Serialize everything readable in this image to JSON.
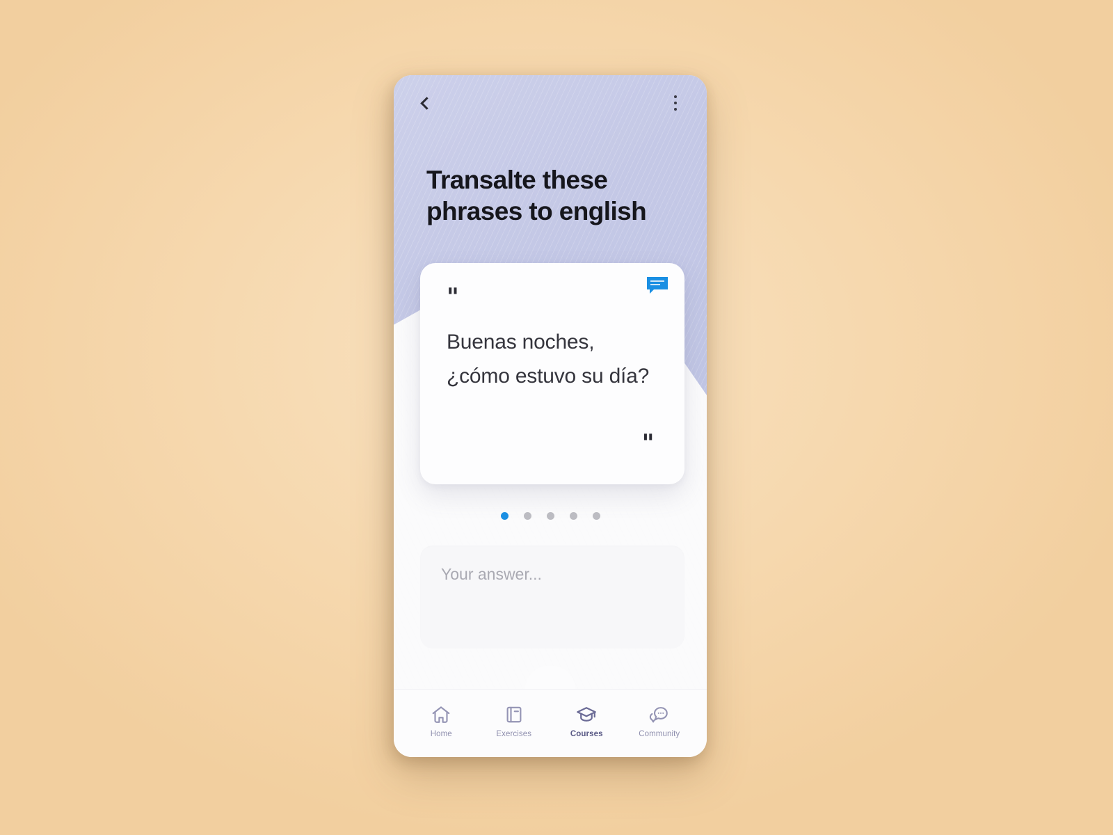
{
  "theme": {
    "page_background": "#f6d9b0",
    "header_purple": "#c4c8e6",
    "accent_blue": "#1a8fe3",
    "nav_inactive": "#8f8fae",
    "nav_active": "#585884",
    "card_background": "#fdfdfe"
  },
  "topbar": {
    "back_icon": "chevron-left-icon",
    "menu_icon": "kebab-menu-icon"
  },
  "header": {
    "title": "Transalte these phrases to english"
  },
  "phrase_card": {
    "open_quote": "\"",
    "close_quote": "\"",
    "icon": "speech-bubble-icon",
    "text": "Buenas noches, ¿cómo estuvo su día?"
  },
  "pagination": {
    "total": 5,
    "active_index": 0,
    "dots": [
      {
        "active": true
      },
      {
        "active": false
      },
      {
        "active": false
      },
      {
        "active": false
      },
      {
        "active": false
      }
    ]
  },
  "answer": {
    "placeholder": "Your answer...",
    "value": ""
  },
  "bottom_nav": {
    "items": [
      {
        "label": "Home",
        "icon": "home-icon",
        "active": false
      },
      {
        "label": "Exercises",
        "icon": "book-icon",
        "active": false
      },
      {
        "label": "Courses",
        "icon": "graduation-cap-icon",
        "active": true
      },
      {
        "label": "Community",
        "icon": "chat-bubbles-icon",
        "active": false
      }
    ]
  }
}
